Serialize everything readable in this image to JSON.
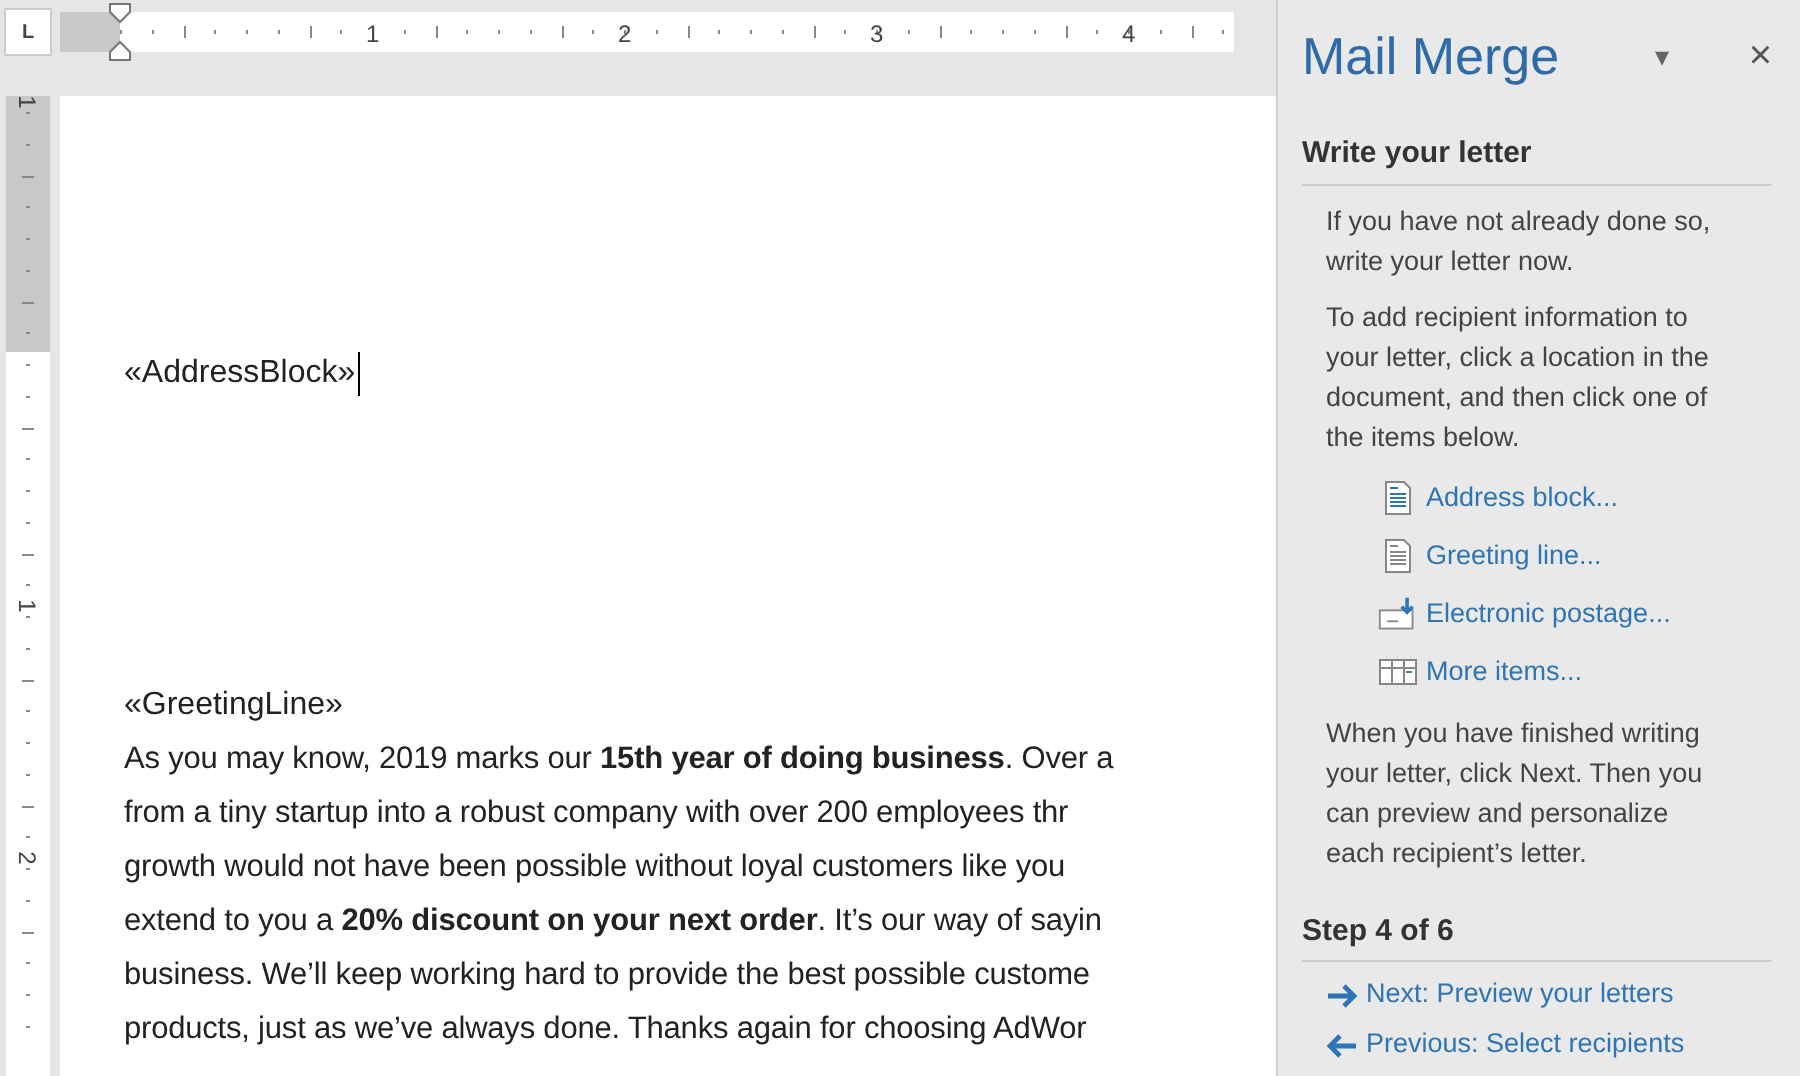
{
  "ruler": {
    "tab_selector": "L",
    "numbers": [
      "1",
      "2",
      "3",
      "4"
    ],
    "vertical_numbers": [
      "1",
      "1",
      "2"
    ]
  },
  "document": {
    "address_block": "«AddressBlock»",
    "greeting_line": "«GreetingLine»",
    "lines": [
      "As you may know, 2019 marks our **15th year of doing business**. Over a",
      "from a tiny startup into a robust company with over 200 employees thr",
      "growth would not have been possible without loyal customers like you",
      "extend to you a **20% discount on your next order**. It’s our way of sayin",
      "business. We’ll keep working hard to provide the best possible custome",
      "products, just as we’ve always done. Thanks again for choosing AdWor"
    ]
  },
  "pane": {
    "title": "Mail Merge",
    "dropdown": "▾",
    "close": "×",
    "section_title": "Write your letter",
    "paragraphs": [
      "If you have not already done so, write your letter now.",
      "To add recipient information to your letter, click a location in the document, and then click one of the items below."
    ],
    "items": [
      {
        "kind": "address",
        "label": "Address block..."
      },
      {
        "kind": "greeting",
        "label": "Greeting line..."
      },
      {
        "kind": "postage",
        "label": "Electronic postage..."
      },
      {
        "kind": "more",
        "label": "More items..."
      }
    ],
    "closing": "When you have finished writing your letter, click Next. Then you can preview and personalize each recipient’s letter.",
    "step": "Step 4 of 6",
    "nav": [
      {
        "kind": "next",
        "label": "Next: Preview your letters"
      },
      {
        "kind": "previous",
        "label": "Previous: Select recipients"
      }
    ]
  }
}
